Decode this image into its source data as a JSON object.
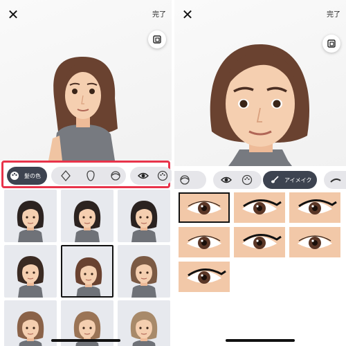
{
  "left": {
    "close_glyph": "✕",
    "done_label": "完了",
    "toolbar": {
      "active_label": "髪の色",
      "icons": [
        "palette-icon",
        "face-shape-icon",
        "face-outline-icon",
        "hair-icon",
        "eye-icon",
        "color-palette-icon"
      ]
    },
    "hair_options": [
      {
        "hair": "#2c2320",
        "selected": false
      },
      {
        "hair": "#2c2320",
        "selected": false
      },
      {
        "hair": "#2a2220",
        "selected": false
      },
      {
        "hair": "#3a2a22",
        "selected": false
      },
      {
        "hair": "#6a4230",
        "selected": true
      },
      {
        "hair": "#7b5a44",
        "selected": false
      },
      {
        "hair": "#8a6248",
        "selected": false
      },
      {
        "hair": "#9a7456",
        "selected": false
      },
      {
        "hair": "#a88a6a",
        "selected": false
      }
    ]
  },
  "right": {
    "close_glyph": "✕",
    "done_label": "完了",
    "toolbar": {
      "active_label": "アイメイク",
      "icons": [
        "hair-icon",
        "eye-icon",
        "palette-icon",
        "brush-icon",
        "eyebrow-icon"
      ]
    },
    "eye_options": [
      {
        "liner": false,
        "selected": true
      },
      {
        "liner": true,
        "selected": false
      },
      {
        "liner": true,
        "selected": false
      },
      {
        "liner": false,
        "selected": false
      },
      {
        "liner": true,
        "selected": false
      },
      {
        "liner": false,
        "selected": false
      },
      {
        "liner": true,
        "selected": false
      }
    ]
  },
  "colors": {
    "highlight": "#e8334a",
    "active_pill": "#3d4350",
    "skin": "#f2c8a8",
    "avatar_hair": "#6a4230",
    "shirt": "#777a80"
  }
}
